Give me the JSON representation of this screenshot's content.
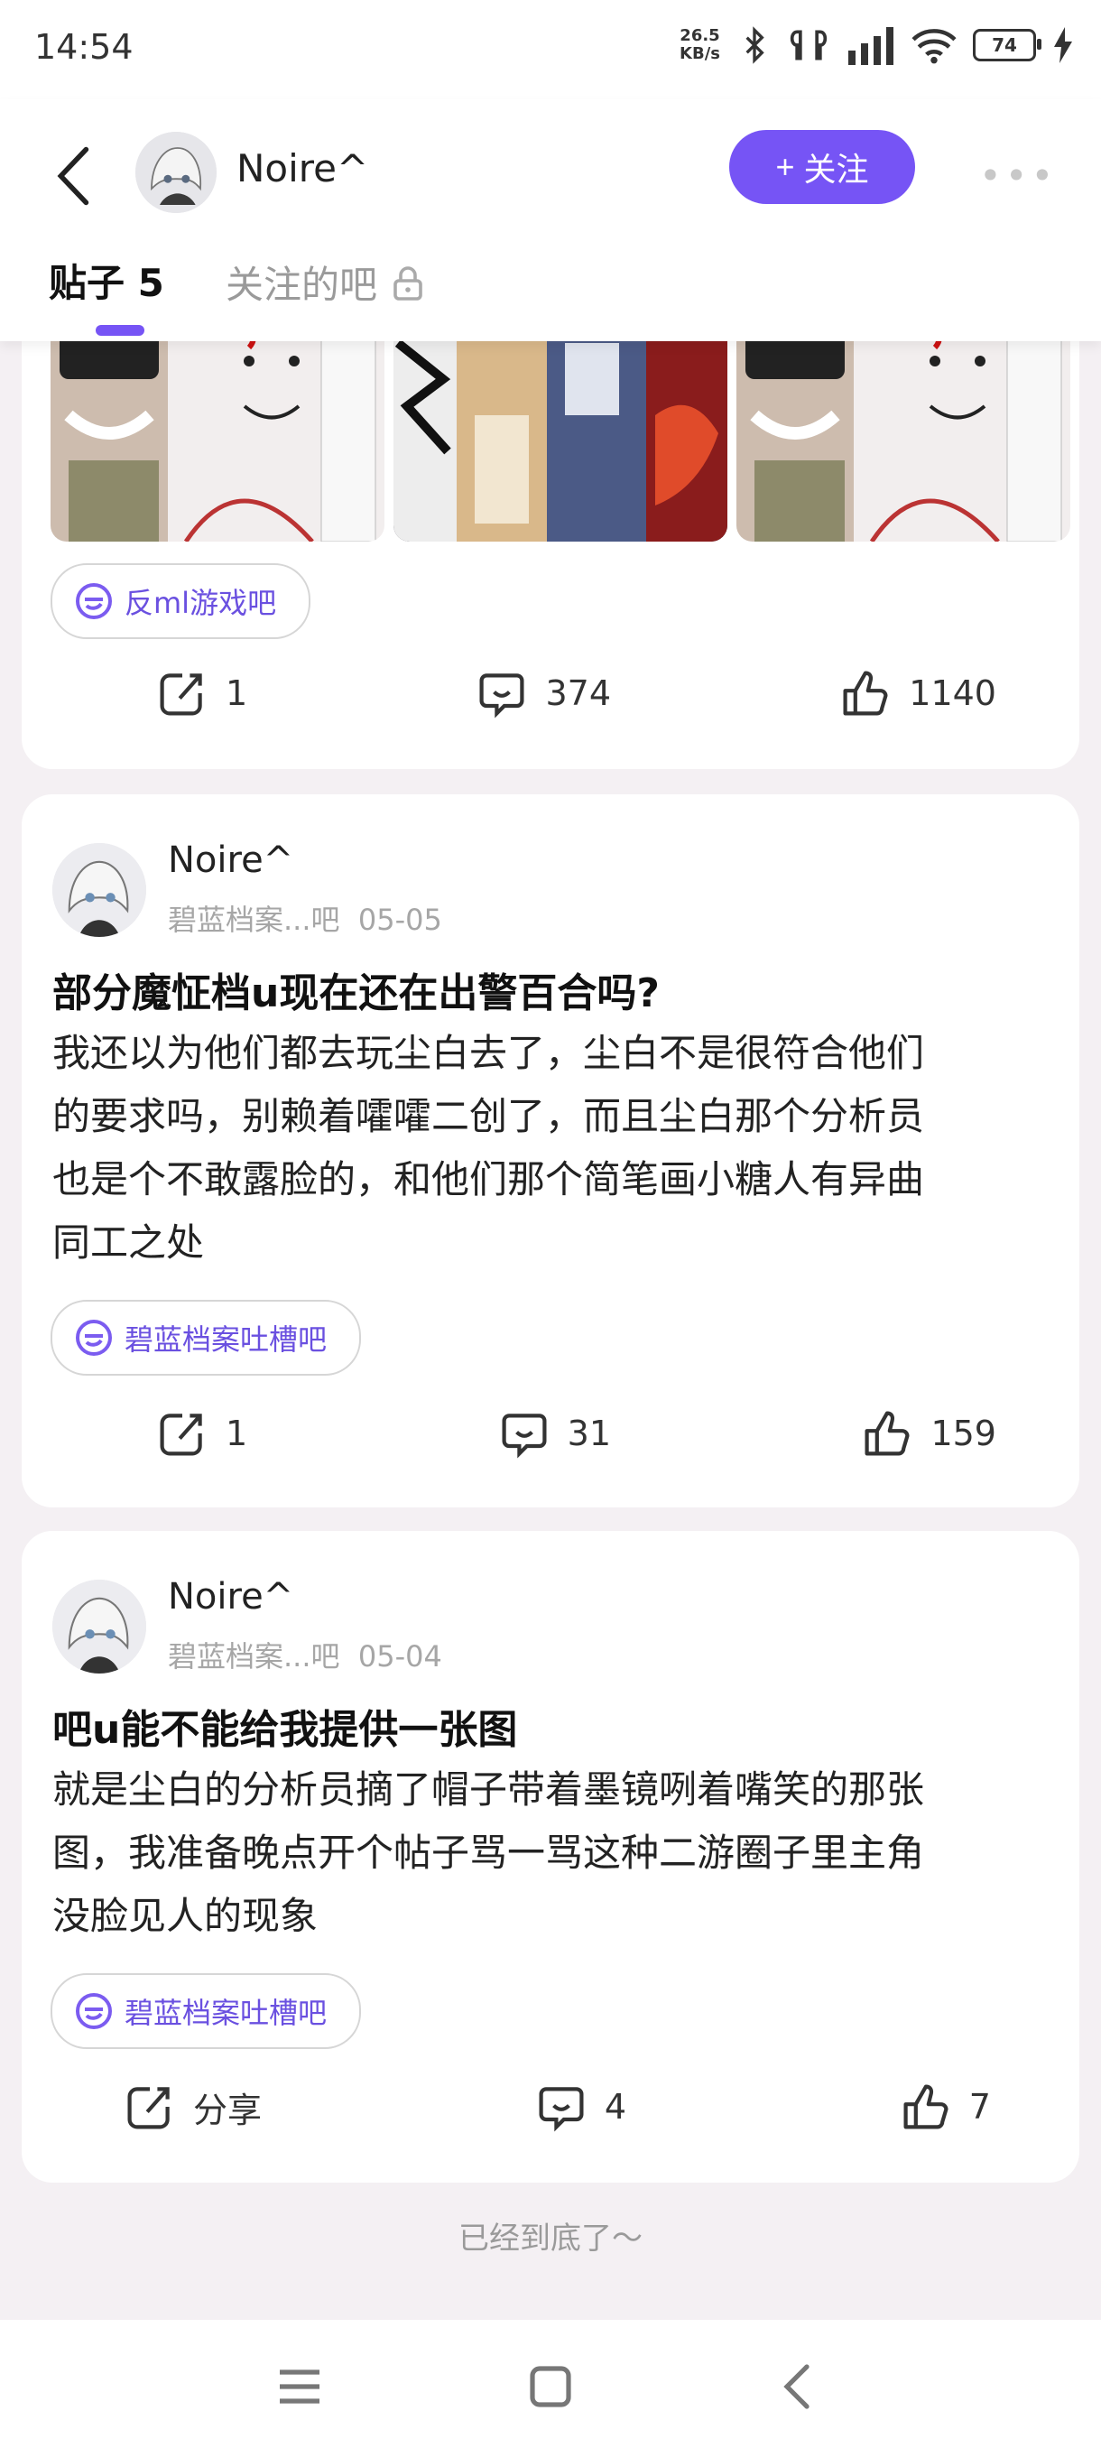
{
  "status_bar": {
    "time": "14:54",
    "net_speed_value": "26.5",
    "net_speed_unit": "KB/s",
    "battery": "74",
    "icons": [
      "bluetooth-icon",
      "earbuds-icon",
      "signal-icon",
      "wifi-icon",
      "battery-icon",
      "charging-icon"
    ]
  },
  "header": {
    "username": "Noire^",
    "follow_label": "关注",
    "follow_plus": "+",
    "more": "•••"
  },
  "tabs": {
    "posts_label": "贴子 5",
    "followed_bars_label": "关注的吧"
  },
  "colors": {
    "accent": "#7654f5",
    "tag_text": "#6a50e0",
    "background": "#f4f0f3"
  },
  "posts": [
    {
      "bar_tag": "反ml游戏吧",
      "share": "1",
      "comments": "374",
      "likes": "1140"
    },
    {
      "author": "Noire^",
      "bar": "碧蓝档案...吧",
      "date": "05-05",
      "title": "部分魔怔档u现在还在出警百合吗?",
      "body_lines": [
        "我还以为他们都去玩尘白去了，尘白不是很符合他们",
        "的要求吗，别赖着嚯嚯二创了，而且尘白那个分析员",
        "也是个不敢露脸的，和他们那个简笔画小糖人有异曲",
        "同工之处"
      ],
      "bar_tag": "碧蓝档案吐槽吧",
      "share": "1",
      "comments": "31",
      "likes": "159"
    },
    {
      "author": "Noire^",
      "bar": "碧蓝档案...吧",
      "date": "05-04",
      "title": "吧u能不能给我提供一张图",
      "body_lines": [
        "就是尘白的分析员摘了帽子带着墨镜咧着嘴笑的那张",
        "图，我准备晚点开个帖子骂一骂这种二游圈子里主角",
        "没脸见人的现象"
      ],
      "bar_tag": "碧蓝档案吐槽吧",
      "share": "分享",
      "comments": "4",
      "likes": "7"
    }
  ],
  "end_text": "已经到底了～"
}
